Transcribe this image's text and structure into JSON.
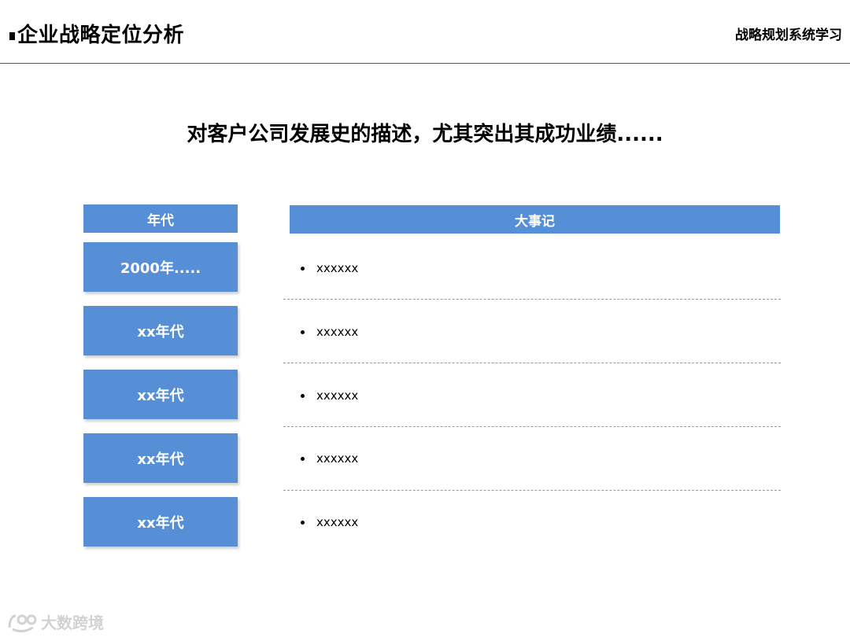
{
  "header": {
    "title": "企业战略定位分析",
    "subtitle": "战略规划系统学习"
  },
  "headline": "对客户公司发展史的描述，尤其突出其成功业绩......",
  "table": {
    "era_header": "年代",
    "events_header": "大事记",
    "rows": [
      {
        "era": "2000年.....",
        "event": "xxxxxx"
      },
      {
        "era": "xx年代",
        "event": "xxxxxx"
      },
      {
        "era": "xx年代",
        "event": "xxxxxx"
      },
      {
        "era": "xx年代",
        "event": "xxxxxx"
      },
      {
        "era": "xx年代",
        "event": "xxxxxx"
      }
    ]
  },
  "watermark": {
    "text": "大数跨境",
    "icon": "brand-logo-icon"
  },
  "colors": {
    "accent": "#568fd6",
    "divider": "#9a9a9a"
  }
}
